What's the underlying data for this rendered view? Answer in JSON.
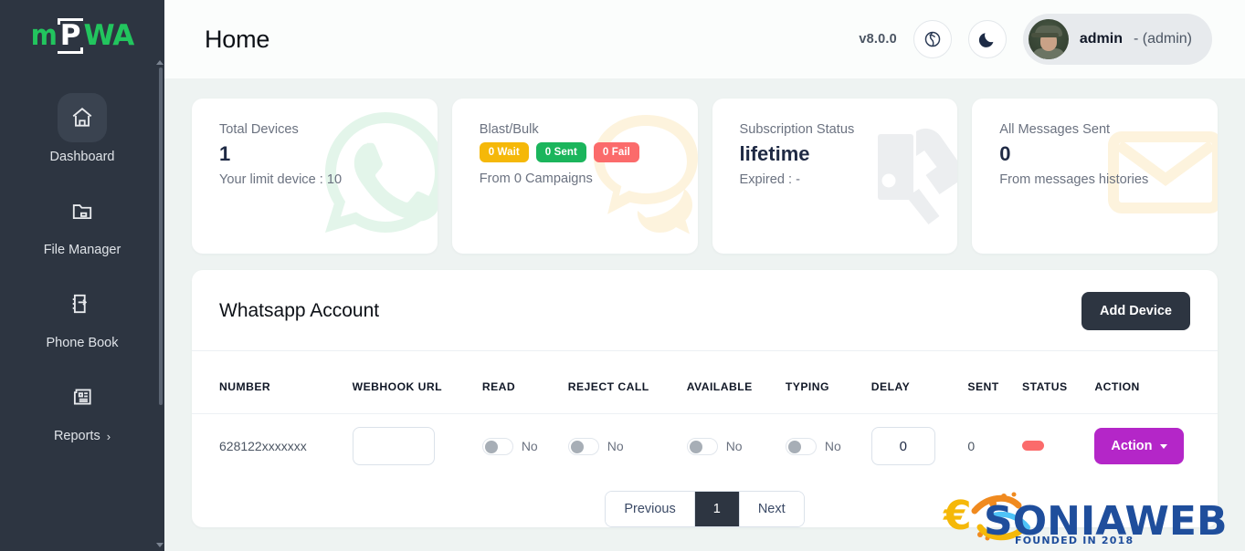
{
  "brand": {
    "logo_m": "m",
    "logo_p": "P",
    "logo_wa": "WA",
    "logo_full": "mPWA",
    "logo_color": "#22c55e"
  },
  "sidebar": {
    "items": [
      {
        "label": "Dashboard",
        "icon": "home-icon",
        "active": true
      },
      {
        "label": "File Manager",
        "icon": "folder-icon",
        "active": false
      },
      {
        "label": "Phone Book",
        "icon": "phone-book-icon",
        "active": false
      },
      {
        "label": "Reports",
        "icon": "reports-icon",
        "active": false,
        "chevron": "›"
      }
    ]
  },
  "header": {
    "title": "Home",
    "version": "v8.0.0",
    "language_icon": "globe-icon",
    "theme_icon": "moon-icon",
    "user_name": "admin",
    "user_role": "- (admin)"
  },
  "cards": [
    {
      "label": "Total Devices",
      "value": "1",
      "sub": "Your limit device : 10",
      "bg_icon": "whatsapp-icon",
      "bg_color": "#e3f5ea"
    },
    {
      "label": "Blast/Bulk",
      "value": "",
      "sub": "From 0 Campaigns",
      "bg_icon": "chat-bubble-icon",
      "bg_color": "#fdf3dd",
      "badges": [
        {
          "text": "0 Wait",
          "color": "#f5b809"
        },
        {
          "text": "0 Sent",
          "color": "#1bb55c"
        },
        {
          "text": "0 Fail",
          "color": "#fb6b6b"
        }
      ]
    },
    {
      "label": "Subscription Status",
      "value": "lifetime",
      "sub": "Expired : -",
      "bg_icon": "handshake-icon",
      "bg_color": "#eceef0"
    },
    {
      "label": "All Messages Sent",
      "value": "0",
      "sub": "From messages histories",
      "bg_icon": "envelope-icon",
      "bg_color": "#fdf3dd"
    }
  ],
  "panel": {
    "title": "Whatsapp Account",
    "add_device_label": "Add Device",
    "columns": [
      "NUMBER",
      "WEBHOOK URL",
      "READ",
      "REJECT CALL",
      "AVAILABLE",
      "TYPING",
      "DELAY",
      "SENT",
      "STATUS",
      "ACTION"
    ],
    "rows": [
      {
        "number": "628122xxxxxxx",
        "webhook_url": "",
        "webhook_placeholder": "",
        "read": {
          "on": false,
          "text": "No"
        },
        "reject_call": {
          "on": false,
          "text": "No"
        },
        "available": {
          "on": false,
          "text": "No"
        },
        "typing": {
          "on": false,
          "text": "No"
        },
        "delay": "0",
        "sent": "0",
        "status": {
          "color": "#fb6b6b",
          "label": ""
        },
        "action_label": "Action"
      }
    ],
    "pagination": {
      "previous": "Previous",
      "pages": [
        "1"
      ],
      "next": "Next",
      "current": "1"
    }
  },
  "watermark": {
    "text_main": "SONIAWEB",
    "text_sub": "FOUNDED IN 2018",
    "euro": "€"
  }
}
